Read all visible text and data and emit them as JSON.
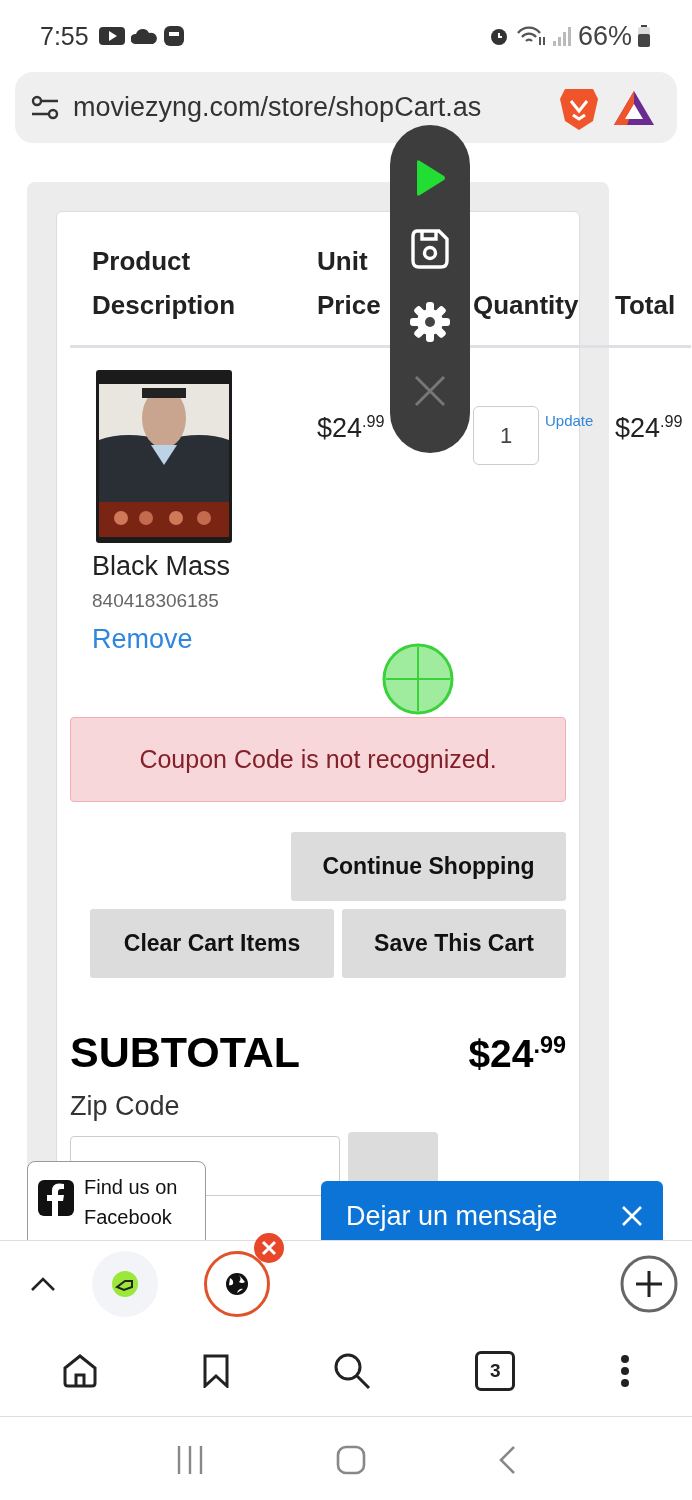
{
  "status_bar": {
    "time": "7:55",
    "battery": "66%"
  },
  "address_bar": {
    "url": "moviezyng.com/store/shopCart.as"
  },
  "cart": {
    "columns": [
      "Product Description",
      "Unit Price",
      "Quantity",
      "Total"
    ],
    "items": [
      {
        "name": "Black Mass",
        "sku": "840418306185",
        "remove": "Remove",
        "price": "$24$^{.99}$",
        "quantity": "1",
        "update": "Update",
        "total": "$24$^{.99}$"
      }
    ]
  },
  "alert": "Coupon Code is not recognized.",
  "buttons": {
    "continue": "Continue Shopping",
    "clear": "Clear Cart Items",
    "save": "Save This Cart"
  },
  "subtotal": {
    "label": "SUBTOTAL",
    "value": "$24$^{.99}$"
  },
  "zip": {
    "label": "Zip Code"
  },
  "facebook_badge": "Find us on Facebook",
  "chat_bar": {
    "label": "Dejar un mensaje"
  },
  "toolbar": {
    "tab_count": "3"
  }
}
